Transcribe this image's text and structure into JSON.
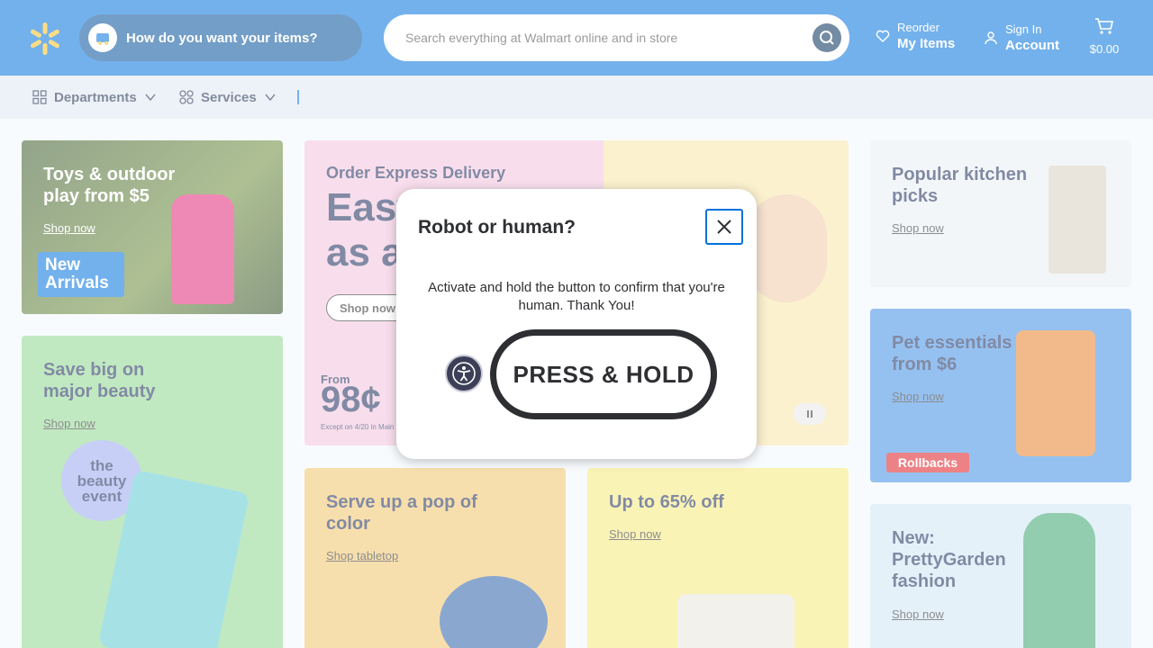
{
  "header": {
    "fulfillment_prompt": "How do you want your items?",
    "search_placeholder": "Search everything at Walmart online and in store",
    "reorder_small": "Reorder",
    "reorder_big": "My Items",
    "signin_small": "Sign In",
    "signin_big": "Account",
    "cart_total": "$0.00"
  },
  "nav": {
    "departments": "Departments",
    "services": "Services"
  },
  "tiles": {
    "toys": {
      "title": "Toys & outdoor play from $5",
      "link": "Shop now",
      "badge": "New Arrivals"
    },
    "beauty": {
      "title": "Save big on major beauty",
      "link": "Shop now",
      "badge": "the beauty event"
    },
    "hero": {
      "eyebrow": "Order Express Delivery",
      "headline_1": "East",
      "headline_2": "as ar",
      "button": "Shop now",
      "price_from": "From",
      "price": "98¢",
      "fine_print": "Except on 4/20 in Main"
    },
    "kitchen": {
      "title": "Popular kitchen picks",
      "link": "Shop now"
    },
    "pet": {
      "title": "Pet essentials from $6",
      "link": "Shop now",
      "badge": "Rollbacks"
    },
    "fashion": {
      "title": "New: PrettyGarden fashion",
      "link": "Shop now"
    },
    "pop": {
      "title": "Serve up a pop of color",
      "link": "Shop tabletop"
    },
    "bags": {
      "title": "Up to 65% off",
      "link": "Shop now"
    }
  },
  "modal": {
    "title": "Robot or human?",
    "message": "Activate and hold the button to confirm that you're human. Thank You!",
    "button": "PRESS & HOLD"
  },
  "colors": {
    "brand_blue": "#0071dc",
    "spark_yellow": "#ffc220",
    "dark_navy": "#002d58"
  }
}
